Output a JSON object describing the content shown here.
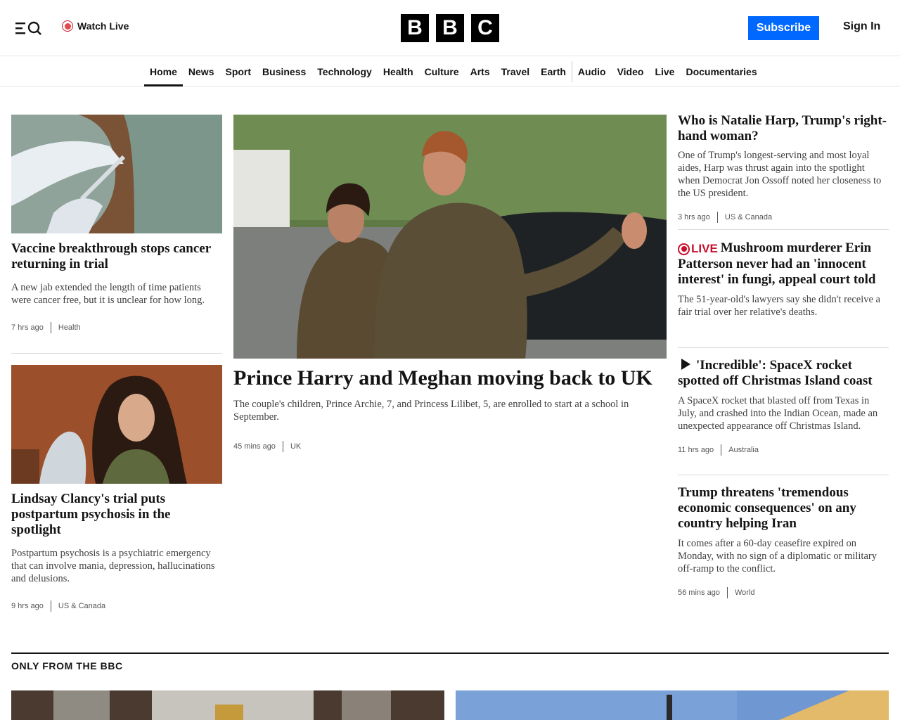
{
  "header": {
    "watch_live": "Watch Live",
    "logo": [
      "B",
      "B",
      "C"
    ],
    "subscribe": "Subscribe",
    "sign_in": "Sign In"
  },
  "nav": {
    "items": [
      "Home",
      "News",
      "Sport",
      "Business",
      "Technology",
      "Health",
      "Culture",
      "Arts",
      "Travel",
      "Earth",
      "Audio",
      "Video",
      "Live",
      "Documentaries"
    ],
    "active": "Home"
  },
  "left": [
    {
      "headline": "Vaccine breakthrough stops cancer returning in trial",
      "summary": "A new jab extended the length of time patients were cancer free, but it is unclear for how long.",
      "time": "7 hrs ago",
      "topic": "Health"
    },
    {
      "headline": "Lindsay Clancy's trial puts postpartum psychosis in the spotlight",
      "summary": "Postpartum psychosis is a psychiatric emergency that can involve mania, depression, hallucinations and delusions.",
      "time": "9 hrs ago",
      "topic": "US & Canada"
    }
  ],
  "lead": {
    "headline": "Prince Harry and Meghan moving back to UK",
    "summary": "The couple's children, Prince Archie, 7, and Princess Lilibet, 5, are enrolled to start at a school in September.",
    "time": "45 mins ago",
    "topic": "UK"
  },
  "right": [
    {
      "headline": "Who is Natalie Harp, Trump's right-hand woman?",
      "summary": "One of Trump's longest-serving and most loyal aides, Harp was thrust again into the spotlight when Democrat Jon Ossoff noted her closeness to the US president.",
      "time": "3 hrs ago",
      "topic": "US & Canada"
    },
    {
      "live_label": "LIVE",
      "headline": "Mushroom murderer Erin Patterson never had an 'innocent interest' in fungi, appeal court told",
      "summary": "The 51-year-old's lawyers say she didn't receive a fair trial over her relative's deaths."
    },
    {
      "headline": "'Incredible': SpaceX rocket spotted off Christmas Island coast",
      "summary": "A SpaceX rocket that blasted off from Texas in July, and crashed into the Indian Ocean, made an unexpected appearance off Christmas Island.",
      "time": "11 hrs ago",
      "topic": "Australia"
    },
    {
      "headline": "Trump threatens 'tremendous economic consequences' on any country helping Iran",
      "summary": "It comes after a 60-day ceasefire expired on Monday, with no sign of a diplomatic or military off-ramp to the conflict.",
      "time": "56 mins ago",
      "topic": "World"
    }
  ],
  "section": {
    "title": "ONLY FROM THE BBC"
  },
  "colors": {
    "brand_black": "#000000",
    "subscribe_blue": "#0068ff",
    "live_red": "#c8102e"
  }
}
